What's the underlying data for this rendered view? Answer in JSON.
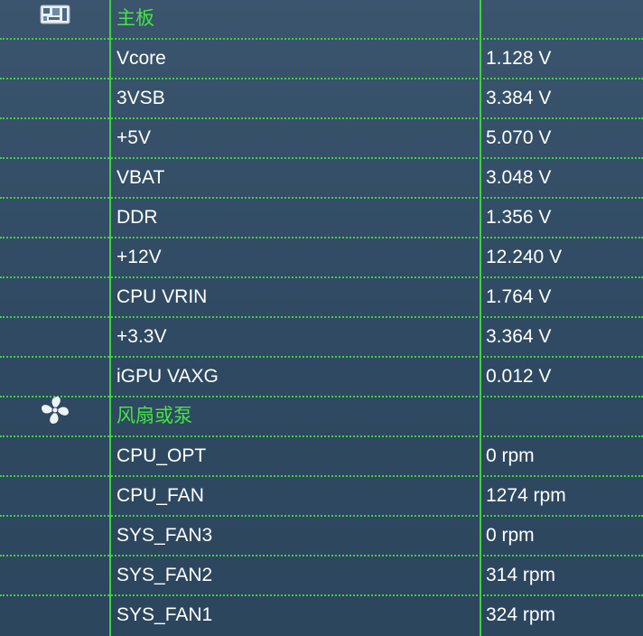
{
  "colors": {
    "grid_line": "#3fd13f",
    "category_text": "#46e446",
    "value_text": "#ffffff"
  },
  "rows": [
    {
      "kind": "category",
      "icon": "motherboard-icon",
      "name": "主板",
      "value": ""
    },
    {
      "kind": "sensor",
      "name": "Vcore",
      "value": "1.128 V"
    },
    {
      "kind": "sensor",
      "name": "3VSB",
      "value": "3.384 V"
    },
    {
      "kind": "sensor",
      "name": "+5V",
      "value": "5.070 V"
    },
    {
      "kind": "sensor",
      "name": "VBAT",
      "value": "3.048 V"
    },
    {
      "kind": "sensor",
      "name": "DDR",
      "value": "1.356 V"
    },
    {
      "kind": "sensor",
      "name": "+12V",
      "value": "12.240 V"
    },
    {
      "kind": "sensor",
      "name": "CPU VRIN",
      "value": "1.764 V"
    },
    {
      "kind": "sensor",
      "name": "+3.3V",
      "value": "3.364 V"
    },
    {
      "kind": "sensor",
      "name": "iGPU VAXG",
      "value": "0.012 V"
    },
    {
      "kind": "category",
      "icon": "fan-icon",
      "name": "风扇或泵",
      "value": ""
    },
    {
      "kind": "sensor",
      "name": "CPU_OPT",
      "value": "0 rpm"
    },
    {
      "kind": "sensor",
      "name": "CPU_FAN",
      "value": "1274 rpm"
    },
    {
      "kind": "sensor",
      "name": "SYS_FAN3",
      "value": "0 rpm"
    },
    {
      "kind": "sensor",
      "name": "SYS_FAN2",
      "value": "314 rpm"
    },
    {
      "kind": "sensor",
      "name": "SYS_FAN1",
      "value": "324 rpm"
    }
  ]
}
